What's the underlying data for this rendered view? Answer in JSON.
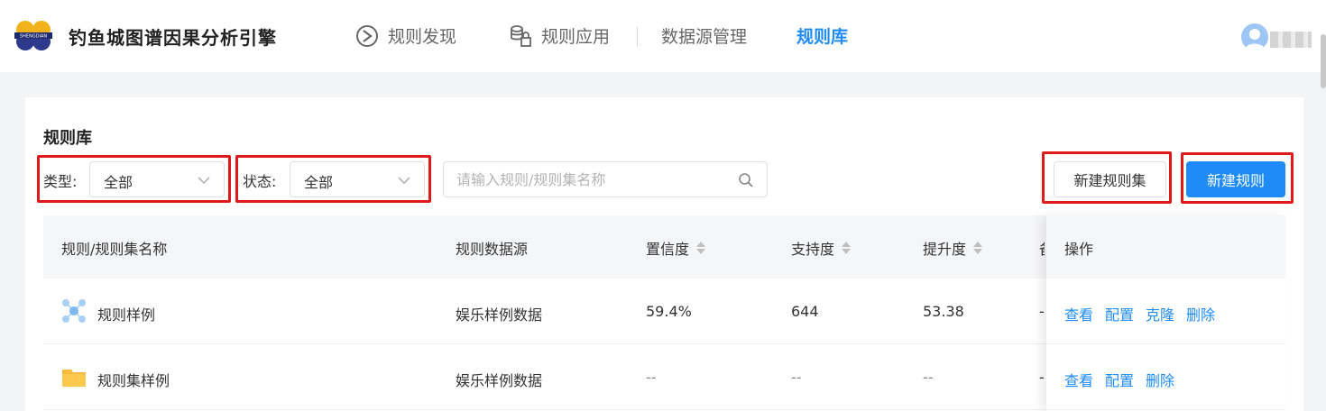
{
  "app": {
    "title": "钓鱼城图谱因果分析引擎",
    "logo_text": "SHENGDIAN"
  },
  "nav": {
    "items": [
      {
        "label": "规则发现",
        "icon": "rule-discover-icon",
        "active": false
      },
      {
        "label": "规则应用",
        "icon": "rule-apply-icon",
        "active": false
      },
      {
        "label": "数据源管理",
        "active": false
      },
      {
        "label": "规则库",
        "active": true
      }
    ]
  },
  "user": {
    "avatar_icon": "user-avatar-icon"
  },
  "page": {
    "title": "规则库",
    "filters": {
      "type_label": "类型:",
      "type_value": "全部",
      "status_label": "状态:",
      "status_value": "全部"
    },
    "search": {
      "placeholder": "请输入规则/规则集名称"
    },
    "buttons": {
      "new_rule_set": "新建规则集",
      "new_rule": "新建规则"
    }
  },
  "table": {
    "columns": {
      "name": "规则/规则集名称",
      "source": "规则数据源",
      "confidence": "置信度",
      "support": "支持度",
      "lift": "提升度",
      "partial": "备",
      "actions": "操作"
    },
    "rows": [
      {
        "icon": "rule-node-icon",
        "name": "规则样例",
        "source": "娱乐样例数据",
        "confidence": "59.4%",
        "support": "644",
        "lift": "53.38",
        "partial": "-",
        "actions": [
          "查看",
          "配置",
          "克隆",
          "删除"
        ]
      },
      {
        "icon": "folder-icon",
        "name": "规则集样例",
        "source": "娱乐样例数据",
        "confidence": "--",
        "support": "--",
        "lift": "--",
        "partial": "-",
        "actions": [
          "查看",
          "配置",
          "删除"
        ]
      }
    ]
  },
  "colors": {
    "primary": "#1e8bf7",
    "highlight_box": "#e01a1a",
    "header_bg": "#f5f6f8"
  }
}
